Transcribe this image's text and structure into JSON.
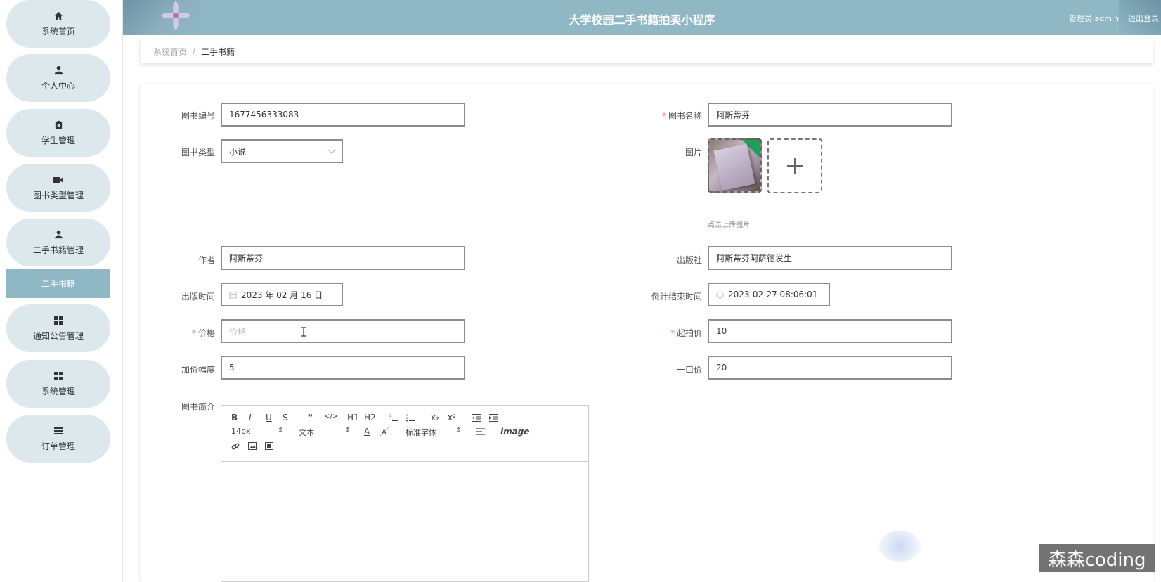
{
  "app": {
    "title": "大学校园二手书籍拍卖小程序",
    "user_label": "管理员 admin",
    "logout_label": "退出登录"
  },
  "sidebar": {
    "items": [
      {
        "label": "系统首页",
        "icon": "home-icon"
      },
      {
        "label": "个人中心",
        "icon": "user-icon"
      },
      {
        "label": "学生管理",
        "icon": "clipboard-icon"
      },
      {
        "label": "图书类型管理",
        "icon": "camera-icon"
      },
      {
        "label": "二手书籍管理",
        "icon": "user-icon"
      },
      {
        "label": "通知公告管理",
        "icon": "grid-icon"
      },
      {
        "label": "系统管理",
        "icon": "grid-icon"
      },
      {
        "label": "订单管理",
        "icon": "list-icon"
      }
    ],
    "active_sub": "二手书籍"
  },
  "breadcrumb": {
    "home": "系统首页",
    "separator": "/",
    "current": "二手书籍"
  },
  "form": {
    "book_no": {
      "label": "图书编号",
      "value": "1677456333083"
    },
    "book_name": {
      "label": "图书名称",
      "value": "阿斯蒂芬",
      "required": true
    },
    "book_type": {
      "label": "图书类型",
      "value": "小说"
    },
    "image": {
      "label": "图片",
      "tip": "点击上传图片"
    },
    "author": {
      "label": "作者",
      "value": "阿斯蒂芬"
    },
    "publisher": {
      "label": "出版社",
      "value": "阿斯蒂芬阿萨德发生"
    },
    "publish_date": {
      "label": "出版时间",
      "value": "2023 年 02 月 16 日"
    },
    "countdown_end": {
      "label": "倒计结束时间",
      "value": "2023-02-27 08:06:01"
    },
    "price": {
      "label": "价格",
      "value": "",
      "placeholder": "价格",
      "required": true
    },
    "start_price": {
      "label": "起拍价",
      "value": "10",
      "required": true
    },
    "increment": {
      "label": "加价幅度",
      "value": "5"
    },
    "buyout_price": {
      "label": "一口价",
      "value": "20"
    },
    "intro": {
      "label": "图书简介"
    }
  },
  "editor": {
    "font_size": "14px",
    "paragraph": "文本",
    "font_family": "标准字体",
    "buttons": [
      "B",
      "I",
      "U",
      "S",
      "❞",
      "</>",
      "H1",
      "H2",
      "ol",
      "ul",
      "x₂",
      "x²",
      "outdent",
      "indent",
      "A",
      "bg",
      "align",
      "Tx",
      "link",
      "image",
      "video"
    ]
  },
  "watermark": "森森coding"
}
